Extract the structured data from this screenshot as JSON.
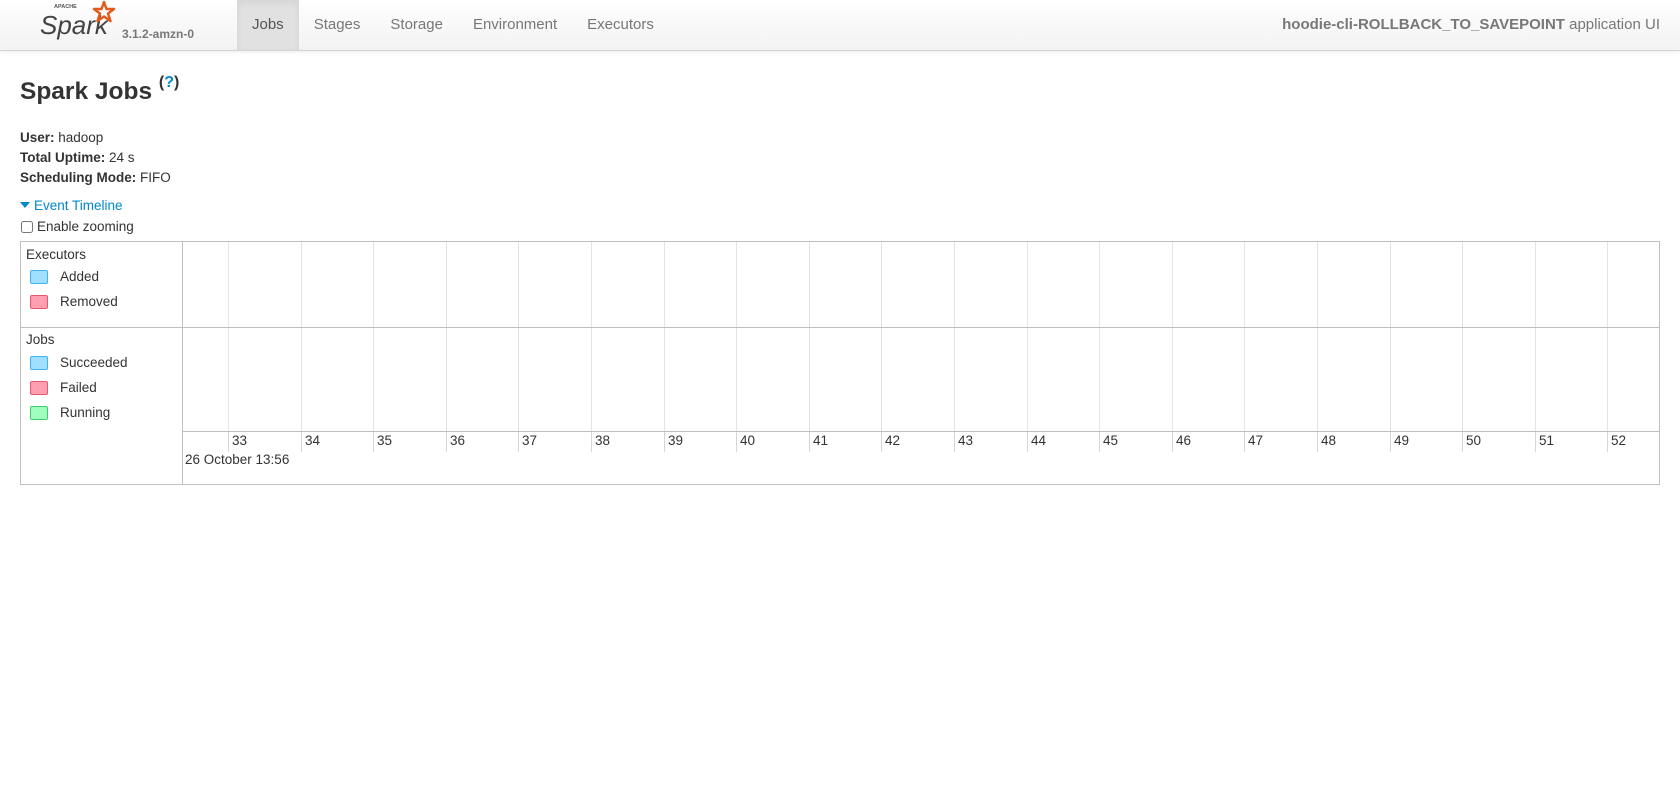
{
  "navbar": {
    "brand_top": "APACHE",
    "brand": "Spark",
    "version": "3.1.2-amzn-0",
    "tabs": [
      {
        "label": "Jobs",
        "active": true
      },
      {
        "label": "Stages"
      },
      {
        "label": "Storage"
      },
      {
        "label": "Environment"
      },
      {
        "label": "Executors"
      }
    ],
    "app_name": "hoodie-cli-ROLLBACK_TO_SAVEPOINT",
    "app_suffix": " application UI"
  },
  "page": {
    "title": "Spark Jobs",
    "help": "?",
    "summary": {
      "user_label": "User:",
      "user": " hadoop",
      "uptime_label": "Total Uptime:",
      "uptime": " 24 s",
      "mode_label": "Scheduling Mode:",
      "mode": " FIFO"
    },
    "event_timeline": "Event Timeline",
    "enable_zooming": "Enable zooming",
    "enable_zooming_checked": false
  },
  "timeline": {
    "executors": {
      "label": "Executors",
      "legend": [
        {
          "label": "Added",
          "color": "#a0dfff"
        },
        {
          "label": "Removed",
          "color": "#ff9fb0"
        }
      ]
    },
    "jobs": {
      "label": "Jobs",
      "legend": [
        {
          "label": "Succeeded",
          "color": "#a0dfff"
        },
        {
          "label": "Failed",
          "color": "#ff9fb0"
        },
        {
          "label": "Running",
          "color": "#a0ffbf"
        }
      ]
    },
    "ticks": [
      "33",
      "34",
      "35",
      "36",
      "37",
      "38",
      "39",
      "40",
      "41",
      "42",
      "43",
      "44",
      "45",
      "46",
      "47",
      "48",
      "49",
      "50",
      "51",
      "52"
    ],
    "date": "26 October 13:56"
  }
}
